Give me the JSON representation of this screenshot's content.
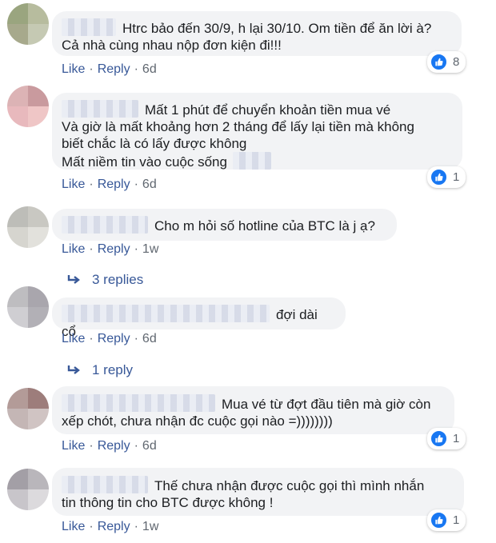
{
  "actions": {
    "like": "Like",
    "reply": "Reply",
    "sep": "·"
  },
  "icons": {
    "like_badge": "thumbs-up-icon",
    "reply_arrow": "reply-arrow-icon"
  },
  "colors": {
    "bubble": "#f2f3f5",
    "link": "#385898",
    "like": "#1877f2"
  },
  "comments": [
    {
      "lines": [
        "Htrc bảo đến 30/9, h lại 30/10. Om tiền để ăn lời à?",
        "Cả nhà cùng nhau nộp đơn kiện đi!!!"
      ],
      "time": "6d",
      "reactions": "8"
    },
    {
      "lines": [
        "Mất 1 phút để chuyển khoản tiền mua vé",
        "Và giờ là mất khoảng hơn 2 tháng để lấy lại tiền mà không",
        "biết chắc là có lấy được không",
        "Mất niềm tin vào cuộc sống"
      ],
      "time": "6d",
      "reactions": "1"
    },
    {
      "lines": [
        "Cho m hỏi số hotline của BTC là j ạ?"
      ],
      "time": "1w",
      "replies": "3 replies"
    },
    {
      "lines": [
        "đợi dài cổ"
      ],
      "time": "6d",
      "replies": "1 reply"
    },
    {
      "lines": [
        "Mua vé từ đợt đầu tiên mà giờ còn",
        "xếp chót, chưa nhận đc cuộc gọi nào =))))))))"
      ],
      "time": "6d",
      "reactions": "1"
    },
    {
      "lines": [
        "Thế chưa nhận được cuộc gọi thì mình nhắn",
        "tin thông tin cho BTC được không !"
      ],
      "time": "1w",
      "reactions": "1"
    }
  ]
}
